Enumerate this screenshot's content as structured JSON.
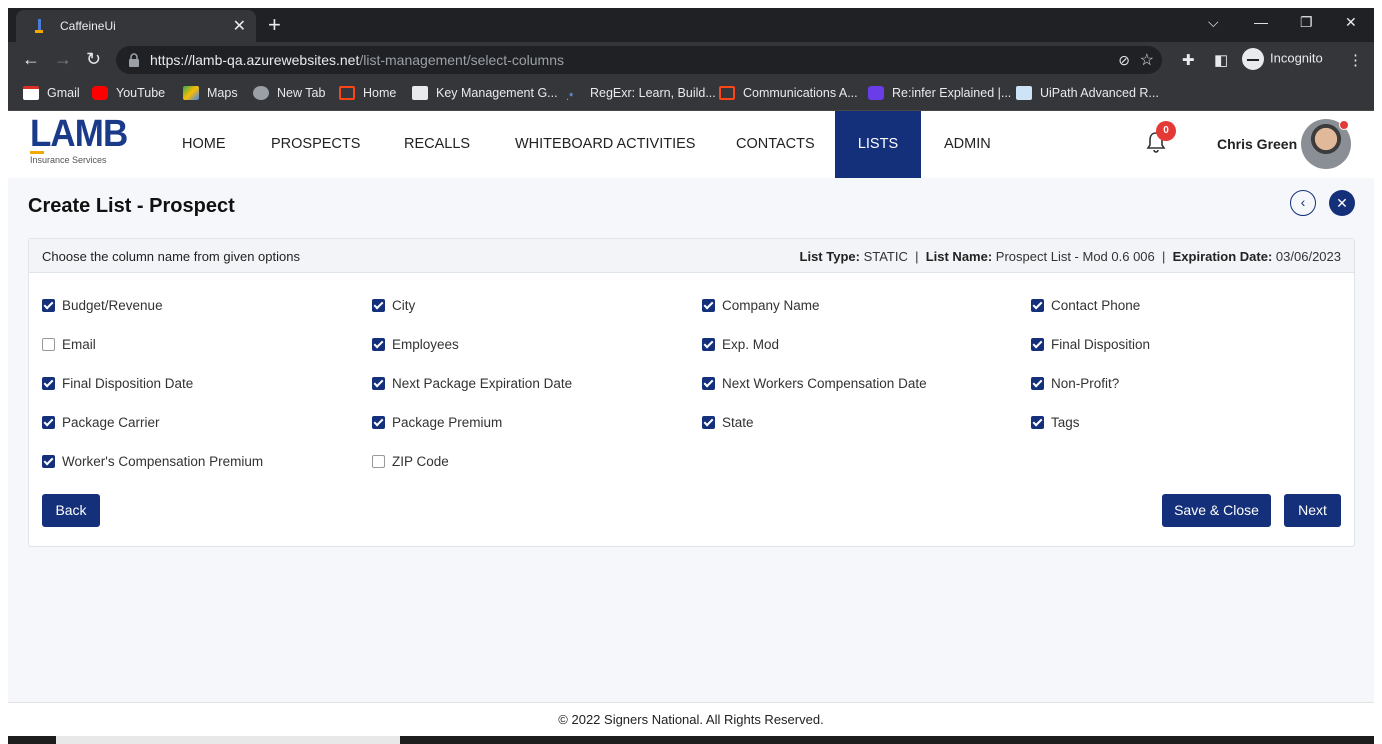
{
  "browser": {
    "tab_title": "CaffeineUi",
    "url_host": "https://lamb-qa.azurewebsites.net",
    "url_path": "/list-management/select-columns",
    "profile_label": "Incognito",
    "bookmarks": [
      "Gmail",
      "YouTube",
      "Maps",
      "New Tab",
      "Home",
      "Key Management G...",
      "RegExr: Learn, Build...",
      "Communications A...",
      "Re:infer Explained |...",
      "UiPath Advanced R..."
    ]
  },
  "header": {
    "logo_text": "LAMB",
    "logo_sub": "Insurance Services",
    "nav": [
      "HOME",
      "PROSPECTS",
      "RECALLS",
      "WHITEBOARD ACTIVITIES",
      "CONTACTS",
      "LISTS",
      "ADMIN"
    ],
    "active_nav": "LISTS",
    "notification_count": "0",
    "user_name": "Chris Green"
  },
  "page": {
    "title": "Create List - Prospect",
    "instructions": "Choose the column name from given options",
    "list_type_label": "List Type:",
    "list_type": "STATIC",
    "list_name_label": "List Name:",
    "list_name": "Prospect List - Mod 0.6 006",
    "expiration_label": "Expiration Date:",
    "expiration_date": "03/06/2023",
    "columns": [
      {
        "label": "Budget/Revenue",
        "checked": true
      },
      {
        "label": "City",
        "checked": true
      },
      {
        "label": "Company Name",
        "checked": true
      },
      {
        "label": "Contact Phone",
        "checked": true
      },
      {
        "label": "Email",
        "checked": false
      },
      {
        "label": "Employees",
        "checked": true
      },
      {
        "label": "Exp. Mod",
        "checked": true
      },
      {
        "label": "Final Disposition",
        "checked": true
      },
      {
        "label": "Final Disposition Date",
        "checked": true
      },
      {
        "label": "Next Package Expiration Date",
        "checked": true
      },
      {
        "label": "Next Workers Compensation Date",
        "checked": true
      },
      {
        "label": "Non-Profit?",
        "checked": true
      },
      {
        "label": "Package Carrier",
        "checked": true
      },
      {
        "label": "Package Premium",
        "checked": true
      },
      {
        "label": "State",
        "checked": true
      },
      {
        "label": "Tags",
        "checked": true
      },
      {
        "label": "Worker's Compensation Premium",
        "checked": true
      },
      {
        "label": "ZIP Code",
        "checked": false
      }
    ],
    "back_label": "Back",
    "save_close_label": "Save & Close",
    "next_label": "Next"
  },
  "footer": {
    "text": "© 2022 Signers National. All Rights Reserved."
  },
  "colors": {
    "primary": "#15307a",
    "badge": "#e53935"
  }
}
